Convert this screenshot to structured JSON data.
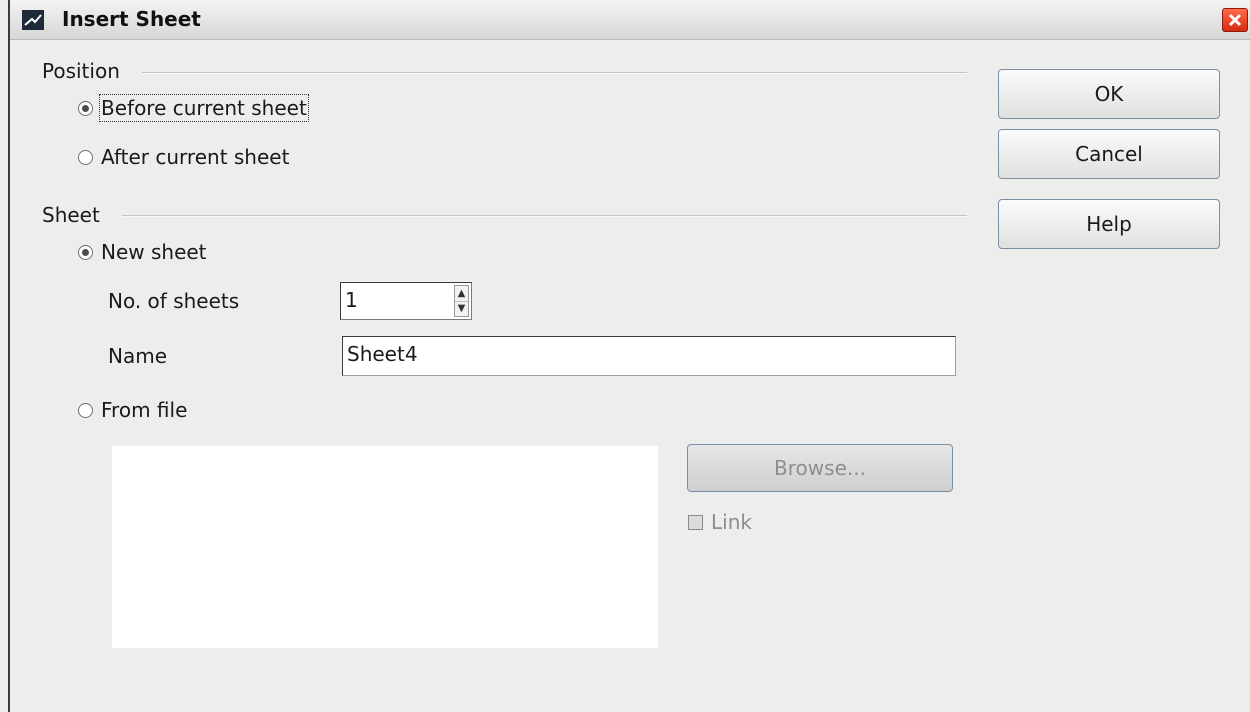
{
  "window": {
    "title": "Insert Sheet",
    "close_icon": "close-icon",
    "app_icon": "spreadsheet-icon"
  },
  "position_group": {
    "label": "Position",
    "before_label": "Before current sheet",
    "after_label": "After current sheet",
    "selected": "before"
  },
  "sheet_group": {
    "label": "Sheet",
    "new_sheet_label": "New sheet",
    "num_sheets_label": "No. of sheets",
    "num_sheets_value": "1",
    "name_label": "Name",
    "name_value": "Sheet4",
    "from_file_label": "From file",
    "browse_label": "Browse...",
    "link_label": "Link",
    "selected": "new"
  },
  "buttons": {
    "ok": "OK",
    "cancel": "Cancel",
    "help": "Help"
  },
  "colors": {
    "close_button": "#d62a10",
    "button_border": "#7d8ea8",
    "dialog_bg": "#ededeb"
  }
}
